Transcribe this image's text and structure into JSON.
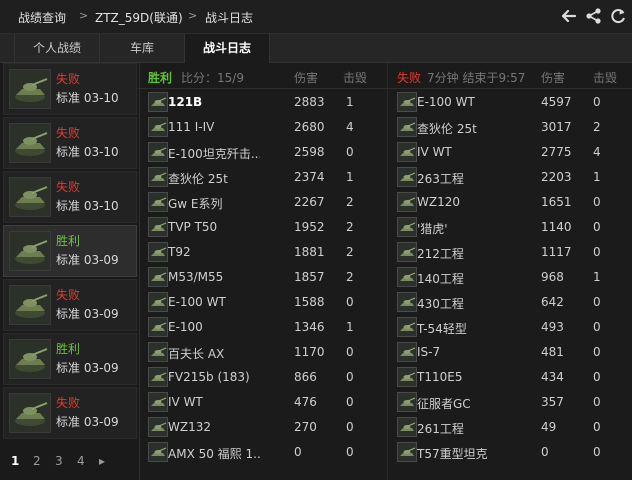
{
  "breadcrumb": {
    "items": [
      "战绩查询",
      "ZTZ_59D(联通)",
      "战斗日志"
    ],
    "separator": ">"
  },
  "toolbar": {
    "back_icon": "back-arrow-icon",
    "share_icon": "share-icon",
    "refresh_icon": "refresh-icon"
  },
  "tabs": [
    {
      "label": "个人战绩",
      "active": false
    },
    {
      "label": "车库",
      "active": false
    },
    {
      "label": "战斗日志",
      "active": true
    }
  ],
  "battles": [
    {
      "result": "失败",
      "result_type": "lose",
      "mode": "标准 03-10",
      "selected": false
    },
    {
      "result": "失败",
      "result_type": "lose",
      "mode": "标准 03-10",
      "selected": false
    },
    {
      "result": "失败",
      "result_type": "lose",
      "mode": "标准 03-10",
      "selected": false
    },
    {
      "result": "胜利",
      "result_type": "win",
      "mode": "标准 03-09",
      "selected": true
    },
    {
      "result": "失败",
      "result_type": "lose",
      "mode": "标准 03-09",
      "selected": false
    },
    {
      "result": "胜利",
      "result_type": "win",
      "mode": "标准 03-09",
      "selected": false
    },
    {
      "result": "失败",
      "result_type": "lose",
      "mode": "标准 03-09",
      "selected": false
    }
  ],
  "pagination": {
    "pages": [
      "1",
      "2",
      "3",
      "4"
    ],
    "current": "1",
    "next": "▸"
  },
  "team_win": {
    "result": "胜利",
    "score": "比分：15/9",
    "col_damage": "伤害",
    "col_kills": "击毁",
    "rows": [
      {
        "name": "121B",
        "damage": "2883",
        "kills": "1",
        "me": true
      },
      {
        "name": "111 I-IV",
        "damage": "2680",
        "kills": "4"
      },
      {
        "name": "E-100坦克歼击...",
        "damage": "2598",
        "kills": "0"
      },
      {
        "name": "查狄伦 25t",
        "damage": "2374",
        "kills": "1"
      },
      {
        "name": "Gw E系列",
        "damage": "2267",
        "kills": "2"
      },
      {
        "name": "TVP T50",
        "damage": "1952",
        "kills": "2"
      },
      {
        "name": "T92",
        "damage": "1881",
        "kills": "2"
      },
      {
        "name": "M53/M55",
        "damage": "1857",
        "kills": "2"
      },
      {
        "name": "E-100 WT",
        "damage": "1588",
        "kills": "0"
      },
      {
        "name": "E-100",
        "damage": "1346",
        "kills": "1"
      },
      {
        "name": "百夫长 AX",
        "damage": "1170",
        "kills": "0"
      },
      {
        "name": "FV215b (183)",
        "damage": "866",
        "kills": "0"
      },
      {
        "name": "IV WT",
        "damage": "476",
        "kills": "0"
      },
      {
        "name": "WZ132",
        "damage": "270",
        "kills": "0"
      },
      {
        "name": "AMX 50 福熙 1...",
        "damage": "0",
        "kills": "0"
      }
    ]
  },
  "team_lose": {
    "result": "失败",
    "info": "7分钟 结束于9:57",
    "col_damage": "伤害",
    "col_kills": "击毁",
    "rows": [
      {
        "name": "E-100 WT",
        "damage": "4597",
        "kills": "0"
      },
      {
        "name": "查狄伦 25t",
        "damage": "3017",
        "kills": "2"
      },
      {
        "name": "IV WT",
        "damage": "2775",
        "kills": "4"
      },
      {
        "name": "263工程",
        "damage": "2203",
        "kills": "1"
      },
      {
        "name": "WZ120",
        "damage": "1651",
        "kills": "0"
      },
      {
        "name": "'猎虎'",
        "damage": "1140",
        "kills": "0"
      },
      {
        "name": "212工程",
        "damage": "1117",
        "kills": "0"
      },
      {
        "name": "140工程",
        "damage": "968",
        "kills": "1"
      },
      {
        "name": "430工程",
        "damage": "642",
        "kills": "0"
      },
      {
        "name": "T-54轻型",
        "damage": "493",
        "kills": "0"
      },
      {
        "name": "IS-7",
        "damage": "481",
        "kills": "0"
      },
      {
        "name": "T110E5",
        "damage": "434",
        "kills": "0"
      },
      {
        "name": "征服者GC",
        "damage": "357",
        "kills": "0"
      },
      {
        "name": "261工程",
        "damage": "49",
        "kills": "0"
      },
      {
        "name": "T57重型坦克",
        "damage": "0",
        "kills": "0"
      }
    ]
  },
  "colors": {
    "win": "#5fc232",
    "lose": "#e03a2e",
    "background": "#1b1b1b"
  }
}
